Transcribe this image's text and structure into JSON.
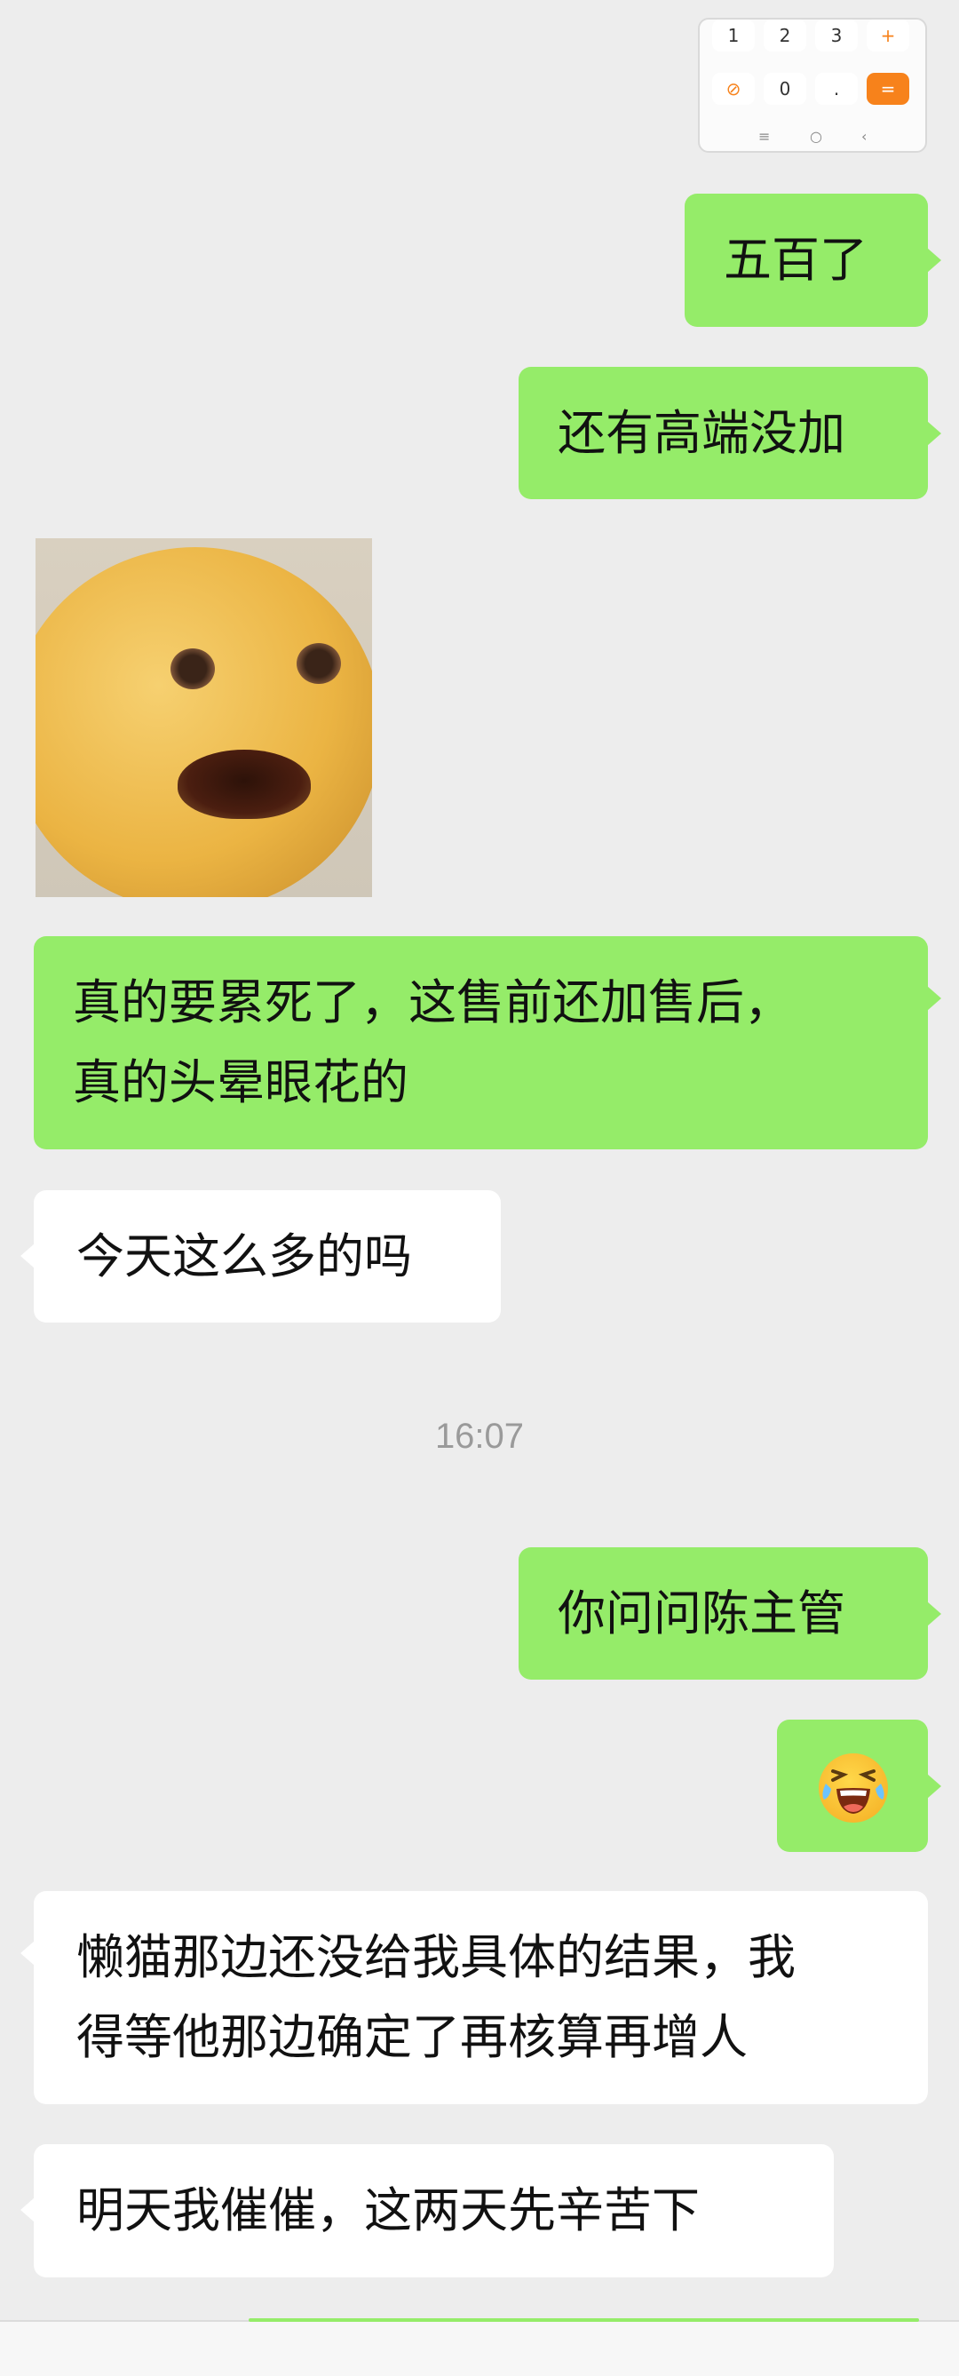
{
  "calculator": {
    "row1": [
      "1",
      "2",
      "3",
      "+"
    ],
    "row2": [
      "0",
      "."
    ],
    "equals": "=",
    "nav": [
      "≡",
      "○",
      "‹"
    ]
  },
  "messages": {
    "m1": "五百了",
    "m2": "还有高端没加",
    "m3_line1": "真的要累死了，这售前还加售后，",
    "m3_line2": "真的头晕眼花的",
    "m4": "今天这么多的吗",
    "timestamp": "16:07",
    "m5": "你问问陈主管",
    "m6_emoji": "grinning-squinting-tears-emoji",
    "m7_line1": "懒猫那边还没给我具体的结果，我",
    "m7_line2": "得等他那边确定了再核算再增人",
    "m8": "明天我催催，这两天先辛苦下"
  },
  "colors": {
    "background": "#ededed",
    "sent_bubble": "#95ec69",
    "received_bubble": "#ffffff",
    "calculator_accent": "#f7821b"
  },
  "icons": {
    "sticker": "lemon-face-sticker",
    "emoji": "laughing-crying-emoji"
  }
}
